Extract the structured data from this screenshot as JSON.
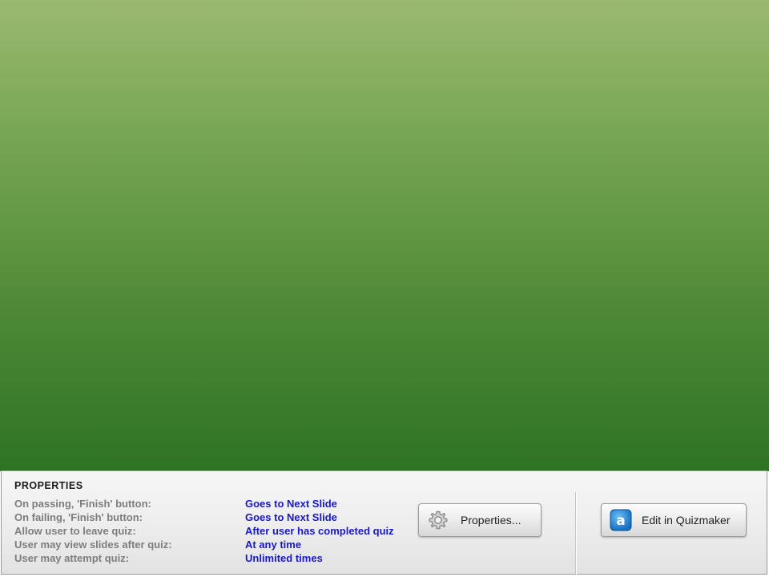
{
  "panel": {
    "heading": "PROPERTIES",
    "rows": [
      {
        "label": "On passing, 'Finish' button:",
        "value": "Goes to Next Slide"
      },
      {
        "label": "On failing, 'Finish' button:",
        "value": "Goes to Next Slide"
      },
      {
        "label": "Allow user to leave quiz:",
        "value": "After user has completed quiz"
      },
      {
        "label": "User may view slides after quiz:",
        "value": "At any time"
      },
      {
        "label": "User may attempt quiz:",
        "value": "Unlimited times"
      }
    ],
    "properties_button": {
      "label": "Properties...",
      "icon": "gear-icon"
    },
    "edit_button": {
      "label": "Edit in Quizmaker",
      "icon": "articulate-a-icon"
    }
  },
  "colors": {
    "slide_top": "#9ab96f",
    "slide_bottom": "#2e7324",
    "label_gray": "#7d7d7d",
    "value_blue": "#1818c8"
  }
}
